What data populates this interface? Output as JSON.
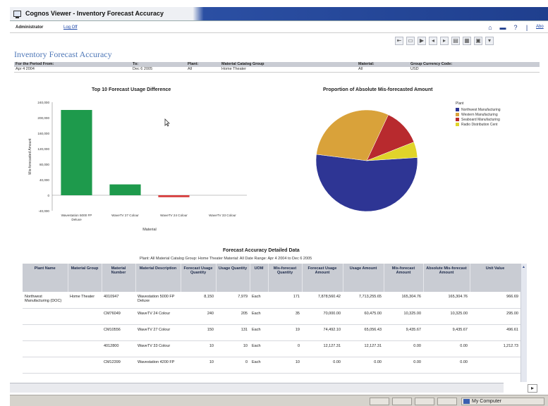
{
  "window": {
    "title": "Cognos Viewer - Inventory Forecast Accuracy"
  },
  "user_bar": {
    "user": "Administrator",
    "logoff": "Log Off",
    "about": "Abo"
  },
  "report": {
    "title": "Inventory Forecast Accuracy",
    "params": {
      "labels": [
        "For the Period From:",
        "To:",
        "Plant:",
        "Material Catalog Group",
        "Material:",
        "Group Currency Code:"
      ],
      "values": [
        "Apr 4 2004",
        "Dec 6 2005",
        "All",
        "Home Theater",
        "All",
        "USD"
      ]
    }
  },
  "colors": {
    "bar_green": "#1e9a4c",
    "bar_red": "#d63a3a",
    "header_gray": "#c9ccd3",
    "title_blue": "#4f78b8"
  },
  "bar_chart": {
    "title": "Top 10 Forecast Usage Difference",
    "ylabel": "Mis-forecasted Amount",
    "xlabel": "Material",
    "ytick_labels": [
      "240,000",
      "200,000",
      "160,000",
      "120,000",
      "80,000",
      "40,000",
      "0",
      "-40,000"
    ]
  },
  "pie_chart": {
    "title": "Proportion of Absolute Mis-forecasted Amount",
    "legend_title": "Plant"
  },
  "chart_data": [
    {
      "type": "bar",
      "title": "Top 10 Forecast Usage Difference",
      "xlabel": "Material",
      "ylabel": "Mis-forecasted Amount",
      "ylim": [
        -40000,
        240000
      ],
      "categories": [
        "Wavestation 5000 FP Deluxe",
        "WaveTV 27 Colour",
        "WaveTV 24 Colour",
        "WaveTV 33 Colour"
      ],
      "values": [
        220000,
        28000,
        -5000,
        0
      ],
      "colors": [
        "#1e9a4c",
        "#1e9a4c",
        "#d63a3a",
        "#1e9a4c"
      ]
    },
    {
      "type": "pie",
      "title": "Proportion of Absolute Mis-forecasted Amount",
      "legend_title": "Plant",
      "labels": [
        "Northwest Manufacturing",
        "Western Manufacturing",
        "Seaboard Manufacturing",
        "Radio Distribution Cent"
      ],
      "values": [
        53,
        30,
        12,
        5
      ],
      "colors": [
        "#2e3594",
        "#d9a23a",
        "#b82a2e",
        "#e0d42a"
      ]
    }
  ],
  "detail": {
    "title": "Forecast Accuracy Detailed Data",
    "subtitle": "Plant: All    Material Catalog Group: Home Theater    Material: All    Date Range: Apr 4 2004 to Dec 6 2005",
    "columns": [
      "Plant Name",
      "Material Group",
      "Material Number",
      "Material Description",
      "Forecast Usage Quantity",
      "Usage Quantity",
      "UOM",
      "Mis-forecast Quantity",
      "Forecast Usage Amount",
      "Usage Amount",
      "Mis-forecast Amount",
      "Absolute Mis-forecast Amount",
      "Unit Value"
    ],
    "rows": [
      [
        "Northwest Manufacturing (DOC)",
        "Home Theater",
        "4010947",
        "Wavestation 5000 FP Deluxe",
        "8,150",
        "7,979",
        "Each",
        "171",
        "7,878,560.42",
        "7,713,255.65",
        "165,304.76",
        "165,304.76",
        "966.69"
      ],
      [
        "",
        "",
        "CM76049",
        "WaveTV 24 Colour",
        "240",
        "205",
        "Each",
        "35",
        "70,000.00",
        "60,475.00",
        "10,325.00",
        "10,325.00",
        "295.00"
      ],
      [
        "",
        "",
        "CM10556",
        "WaveTV 27 Colour",
        "150",
        "131",
        "Each",
        "19",
        "74,492.10",
        "65,056.43",
        "9,435.67",
        "9,435.67",
        "496.61"
      ],
      [
        "",
        "",
        "4012800",
        "WaveTV 33 Colour",
        "10",
        "10",
        "Each",
        "0",
        "12,127.31",
        "12,127.31",
        "0.00",
        "0.00",
        "1,212.73"
      ],
      [
        "",
        "",
        "CM12399",
        "Wavestation 4200 FP",
        "10",
        "0",
        "Each",
        "10",
        "0.00",
        "0.00",
        "0.00",
        "0.00",
        ""
      ]
    ]
  },
  "status": {
    "zone": "My Computer"
  }
}
